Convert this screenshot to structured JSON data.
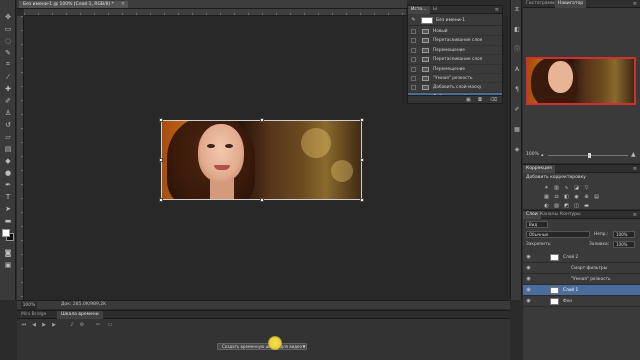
{
  "document": {
    "tab_title": "Без имени-1 @ 100% (Слой 1, RGB/8) *",
    "close_glyph": "×",
    "zoom": "100%",
    "doc_info": "Док: 285,0K/989,2K"
  },
  "history": {
    "tabs": [
      "Исто...",
      "Ы"
    ],
    "snapshot_label": "Без имени-1",
    "items": [
      {
        "label": "Новый",
        "active": false
      },
      {
        "label": "Перетаскивание слоя",
        "active": false
      },
      {
        "label": "Перемещение",
        "active": false
      },
      {
        "label": "Перетаскивание слоя",
        "active": false
      },
      {
        "label": "Перемещение",
        "active": false
      },
      {
        "label": "\"Умная\" резкость",
        "active": false
      },
      {
        "label": "Добавить слой-маску",
        "active": false
      },
      {
        "label": "Добавить слой-маску",
        "active": true
      }
    ]
  },
  "navigator": {
    "tabs": [
      "Гистограмма",
      "Навигатор"
    ],
    "zoom": "100%"
  },
  "adjustments": {
    "tabs": [
      "Коррекция"
    ],
    "title": "Добавить корректировку"
  },
  "layers": {
    "tabs": [
      "Слои",
      "Каналы",
      "Контуры"
    ],
    "kind_label": "Вид",
    "blend_mode": "Обычные",
    "opacity_label": "Непр.:",
    "opacity": "100%",
    "lock_label": "Закрепить:",
    "fill_label": "Заливка:",
    "fill": "100%",
    "rows": [
      {
        "name": "Слой 2",
        "active": false,
        "indent": false
      },
      {
        "name": "Смарт-фильтры",
        "active": false,
        "indent": true
      },
      {
        "name": "\"Умная\" резкость",
        "active": false,
        "indent": true
      },
      {
        "name": "Слой 1",
        "active": true,
        "indent": false
      },
      {
        "name": "Фон",
        "active": false,
        "indent": false
      }
    ]
  },
  "timeline": {
    "tabs": [
      "Mini Bridge",
      "Шкала времени"
    ],
    "create_button": "Создать временную шкалу для видео"
  },
  "colors": {
    "accent_selection": "#4b6d9c",
    "panel_bg": "#3a3a3a",
    "canvas_bg": "#282828",
    "cursor_highlight": "#f4e34a"
  }
}
